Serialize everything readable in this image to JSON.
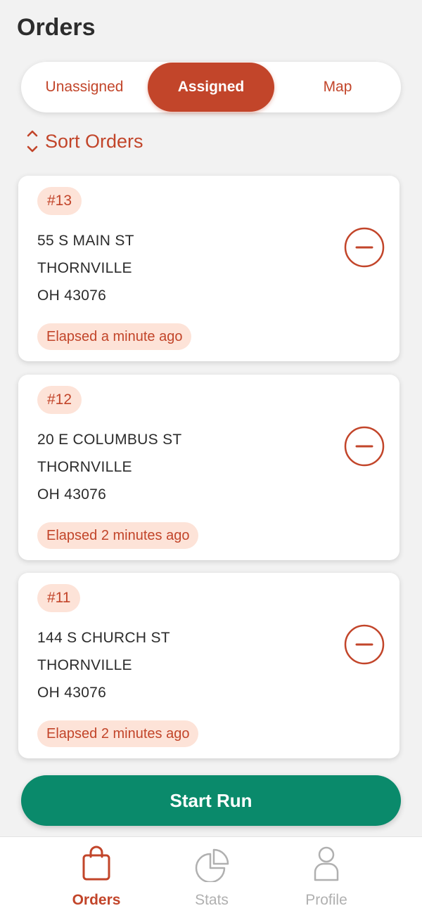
{
  "page": {
    "title": "Orders"
  },
  "tabs": [
    {
      "label": "Unassigned",
      "active": false
    },
    {
      "label": "Assigned",
      "active": true
    },
    {
      "label": "Map",
      "active": false
    }
  ],
  "sort": {
    "label": "Sort Orders",
    "icon": "sort-updown-icon"
  },
  "orders": [
    {
      "number": "#13",
      "street": "55 S MAIN ST",
      "city": "THORNVILLE",
      "state_zip": "OH 43076",
      "elapsed": "Elapsed a minute ago"
    },
    {
      "number": "#12",
      "street": "20 E COLUMBUS ST",
      "city": "THORNVILLE",
      "state_zip": "OH 43076",
      "elapsed": "Elapsed 2 minutes ago"
    },
    {
      "number": "#11",
      "street": "144 S CHURCH ST",
      "city": "THORNVILLE",
      "state_zip": "OH 43076",
      "elapsed": "Elapsed 2 minutes ago"
    }
  ],
  "start_run": {
    "label": "Start Run"
  },
  "nav": [
    {
      "label": "Orders",
      "icon": "shopping-bag-icon",
      "active": true
    },
    {
      "label": "Stats",
      "icon": "pie-chart-icon",
      "active": false
    },
    {
      "label": "Profile",
      "icon": "person-icon",
      "active": false
    }
  ],
  "colors": {
    "accent": "#c2452a",
    "badge_bg": "#fde3d8",
    "start_button": "#0a8a6b",
    "inactive_nav": "#b0b0b0",
    "background": "#f2f2f2"
  }
}
